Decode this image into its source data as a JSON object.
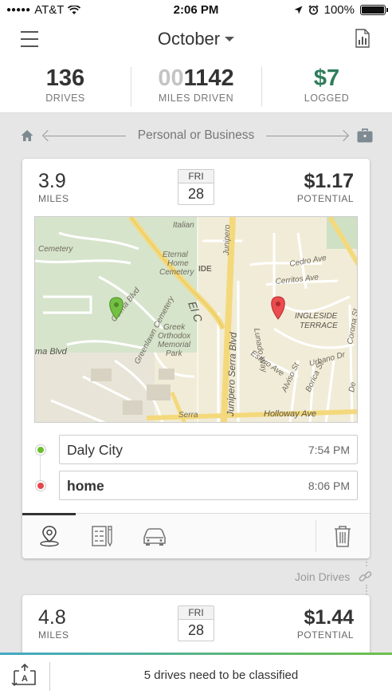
{
  "status_bar": {
    "carrier": "AT&T",
    "time": "2:06 PM",
    "battery": "100%"
  },
  "header": {
    "month": "October"
  },
  "stats": {
    "drives_value": "136",
    "drives_label": "DRIVES",
    "miles_value_dim": "00",
    "miles_value": "1142",
    "miles_label": "MILES DRIVEN",
    "logged_value": "$7",
    "logged_label": "LOGGED"
  },
  "classify_hint": "Personal or Business",
  "drives": [
    {
      "miles": "3.9",
      "miles_unit": "MILES",
      "day": "FRI",
      "date": "28",
      "potential": "$1.17",
      "potential_label": "POTENTIAL",
      "start": {
        "name": "Daly City",
        "time": "7:54 PM"
      },
      "end": {
        "name": "home",
        "time": "8:06 PM"
      },
      "map_labels": [
        "Cemetery",
        "Italian",
        "Eternal Home Cemetery",
        "Colma Blvd",
        "Greenlawn Cemetery",
        "Greek Orthodox Memorial Park",
        "El C",
        "ma Blvd",
        "Junipero Serra Blvd",
        "Junipero",
        "Lunado Way",
        "Cedro Ave",
        "Cerritos Ave",
        "INGLESIDE TERRACE",
        "Urbano Dr",
        "Estero Ave",
        "Alviso St",
        "Borica St",
        "Holloway Ave",
        "Serra",
        "De",
        "Corona St",
        "IDE"
      ]
    },
    {
      "miles": "4.8",
      "miles_unit": "MILES",
      "day": "FRI",
      "date": "28",
      "potential": "$1.44",
      "potential_label": "POTENTIAL"
    }
  ],
  "join_drives": "Join Drives",
  "banner_text": "5 drives need to be classified",
  "icons": [
    "hamburger-icon",
    "caret-down-icon",
    "report-icon",
    "home-icon",
    "briefcase-icon",
    "map-pin-icon",
    "notes-icon",
    "car-icon",
    "trash-icon",
    "link-icon",
    "auto-classify-icon"
  ],
  "colors": {
    "logged_green": "#2f7d5b",
    "start_pin": "#6abf2e",
    "end_pin": "#e9474b",
    "banner_gradient_left": "#43a8c8",
    "banner_gradient_right": "#6cc04a"
  }
}
